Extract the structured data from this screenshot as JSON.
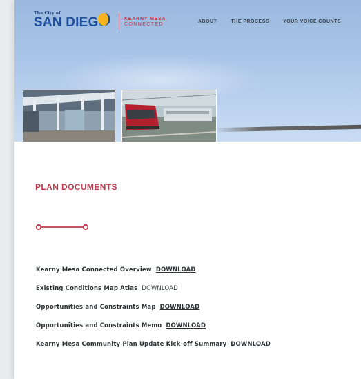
{
  "header": {
    "city_small": "The City of",
    "city_name": "SAN DIEGO",
    "project_name_top": "KEARNY MESA",
    "project_name_bottom": "CONNECTED",
    "nav": [
      {
        "label": "ABOUT"
      },
      {
        "label": "THE PROCESS"
      },
      {
        "label": "YOUR VOICE COUNTS"
      }
    ]
  },
  "hero": {
    "photos": [
      {
        "subject": "transit-station-canopy"
      },
      {
        "subject": "red-trolley-train"
      }
    ]
  },
  "section": {
    "title": "PLAN DOCUMENTS"
  },
  "documents": [
    {
      "label": "Kearny Mesa Connected Overview",
      "link": "DOWNLOAD",
      "linked": true
    },
    {
      "label": "Existing Conditions Map Atlas",
      "link": "DOWNLOAD",
      "linked": false
    },
    {
      "label": "Opportunities and Constraints Map",
      "link": "DOWNLOAD",
      "linked": true
    },
    {
      "label": "Opportunities and Constraints Memo",
      "link": "DOWNLOAD",
      "linked": true
    },
    {
      "label": "Kearny Mesa Community Plan Update Kick-off Summary",
      "link": "DOWNLOAD",
      "linked": true
    }
  ],
  "colors": {
    "accent": "#c0394d",
    "brand_blue": "#1d4f9c",
    "sun_yellow": "#f4b321",
    "text": "#2f3338"
  }
}
